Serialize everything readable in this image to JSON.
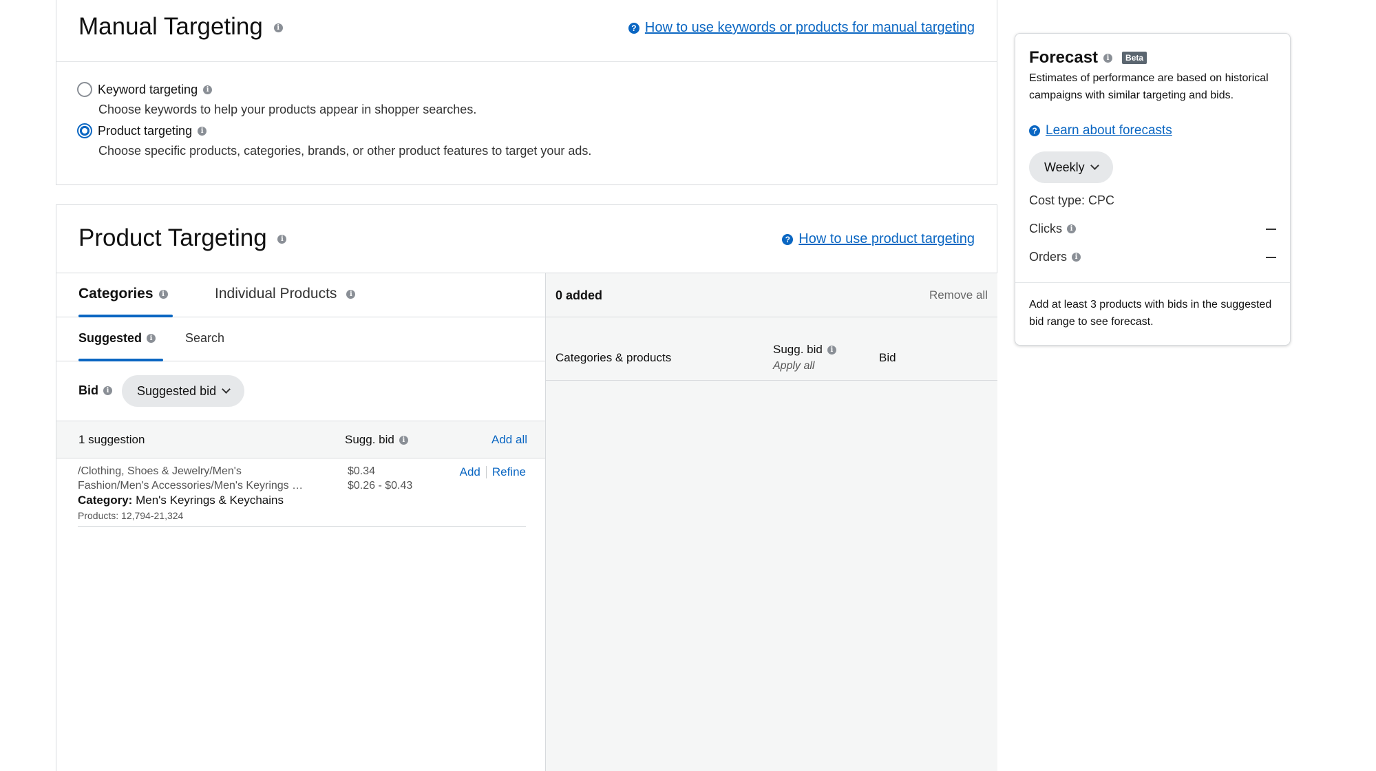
{
  "manual_targeting": {
    "title": "Manual Targeting",
    "help_link": "How to use keywords or products for manual targeting",
    "options": [
      {
        "label": "Keyword targeting",
        "description": "Choose keywords to help your products appear in shopper searches.",
        "selected": false
      },
      {
        "label": "Product targeting",
        "description": "Choose specific products, categories, brands, or other product features to target your ads.",
        "selected": true
      }
    ]
  },
  "product_targeting": {
    "title": "Product Targeting",
    "help_link": "How to use product targeting",
    "tabs": [
      "Categories",
      "Individual Products"
    ],
    "subtabs": [
      "Suggested",
      "Search"
    ],
    "bid_label": "Bid",
    "bid_select": "Suggested bid",
    "table": {
      "count_label": "1 suggestion",
      "sugg_bid_header": "Sugg. bid",
      "add_all": "Add all",
      "rows": [
        {
          "path_line1": "/Clothing, Shoes & Jewelry/Men's",
          "path_line2": "Fashion/Men's Accessories/Men's Keyrings …",
          "category_label": "Category:",
          "category_value": "Men's Keyrings & Keychains",
          "products": "Products: 12,794-21,324",
          "bid": "$0.34",
          "bid_range": "$0.26 - $0.43",
          "add": "Add",
          "refine": "Refine"
        }
      ]
    },
    "added": {
      "count_label": "0 added",
      "remove_all": "Remove all",
      "col_products": "Categories & products",
      "col_sugg_bid": "Sugg. bid",
      "apply_all": "Apply all",
      "col_bid": "Bid"
    }
  },
  "forecast": {
    "title": "Forecast",
    "badge": "Beta",
    "description": "Estimates of performance are based on historical campaigns with similar targeting and bids.",
    "learn_link": "Learn about forecasts",
    "period": "Weekly",
    "cost_type": "Cost type: CPC",
    "metrics": [
      {
        "label": "Clicks",
        "value": "–"
      },
      {
        "label": "Orders",
        "value": "–"
      }
    ],
    "note": "Add at least 3 products with bids in the suggested bid range to see forecast."
  },
  "colors": {
    "accent": "#0a66c2",
    "border": "#d7dadd",
    "pane_bg": "#f5f6f6"
  }
}
